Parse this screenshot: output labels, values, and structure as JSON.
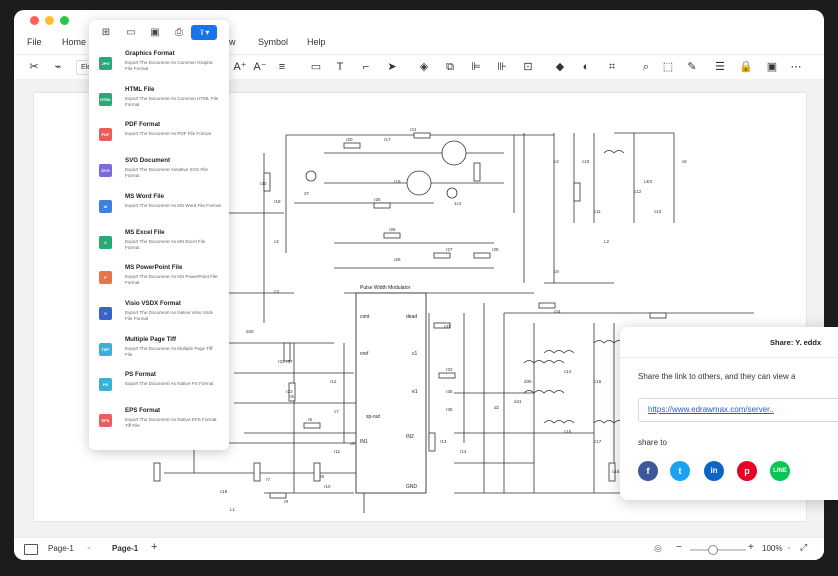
{
  "menu": {
    "file": "File",
    "home": "Home",
    "view_partial": "w",
    "symbol": "Symbol",
    "help": "Help"
  },
  "toolbar": {
    "font_partial": "Ele"
  },
  "export_panel": {
    "items": [
      {
        "title": "Graphics Format",
        "desc": "Export The Document As Common Graphic File Format",
        "badge": "JPG",
        "color": "#2aa876"
      },
      {
        "title": "HTML File",
        "desc": "Export The Document As Common HTML File Format",
        "badge": "HTML",
        "color": "#2aa876"
      },
      {
        "title": "PDF Format",
        "desc": "Export The Document As PDF File Format",
        "badge": "PDF",
        "color": "#e95d5d"
      },
      {
        "title": "SVG Document",
        "desc": "Export The Document Asnative SVG File Format",
        "badge": "SVG",
        "color": "#7b6ad8"
      },
      {
        "title": "MS Word File",
        "desc": "Export The Document As MS Word File Format",
        "badge": "W",
        "color": "#3d7fe3"
      },
      {
        "title": "MS Excel File",
        "desc": "Export The Document As MS Excel File Format",
        "badge": "X",
        "color": "#2aa876"
      },
      {
        "title": "MS PowerPoint File",
        "desc": "Export The Document As MS PowerPoint File Format",
        "badge": "P",
        "color": "#e8744a"
      },
      {
        "title": "Visio VSDX Format",
        "desc": "Export The Document As Native Visio Vsdx File Format",
        "badge": "V",
        "color": "#3a62c9"
      },
      {
        "title": "Multiple Page Tiff",
        "desc": "Export The Document As Multiple Page Tiff File",
        "badge": "TIFF",
        "color": "#3ab0d6"
      },
      {
        "title": "PS Format",
        "desc": "Export The Document As Native PS Format",
        "badge": "PS",
        "color": "#3ab0d6"
      },
      {
        "title": "EPS Format",
        "desc": "Export The Document As Native EPS Format Tiff File",
        "badge": "EPS",
        "color": "#e95d5d"
      }
    ]
  },
  "share": {
    "title": "Share: Y. eddx",
    "description": "Share the link to others, and they can view a",
    "link": "https://www.edrawmax.com/server..",
    "share_to": "share to"
  },
  "circuit": {
    "pwm_title": "Pulse Width Modulator",
    "pins_left": [
      "cont",
      "vref",
      "sp-out",
      "IN1"
    ],
    "pins_right": [
      "dead",
      "c1",
      "e1",
      "IN2",
      "GND"
    ],
    "labels": [
      "r20",
      "r21",
      "r25",
      "r26",
      "r29",
      "r27",
      "r28",
      "r30",
      "r31",
      "r32",
      "r35",
      "r36",
      "r37",
      "r5",
      "r6",
      "r7",
      "r8",
      "r9",
      "r10",
      "r11",
      "r12",
      "r13",
      "r14",
      "c1",
      "c2",
      "c3",
      "c4",
      "c9",
      "c10",
      "c11",
      "c12",
      "c13",
      "c14",
      "c15",
      "c16",
      "c17",
      "c18",
      "c19",
      "L1",
      "L2",
      "LE3",
      "1c4",
      "37",
      "c6",
      "c7",
      "c8",
      "d2",
      "d41",
      "d30",
      "d40",
      "r17",
      "r18",
      "r19",
      "r22",
      "r23",
      "r24"
    ]
  },
  "status": {
    "page_tab_1": "Page-1",
    "page_tab_2": "Page-1",
    "add": "+",
    "zoom": "100%"
  },
  "colors": {
    "accent": "#1a73e8",
    "facebook": "#3b5998",
    "twitter": "#1da1f2",
    "linkedin": "#0a66c2",
    "pinterest": "#e60023",
    "line": "#06c755"
  }
}
